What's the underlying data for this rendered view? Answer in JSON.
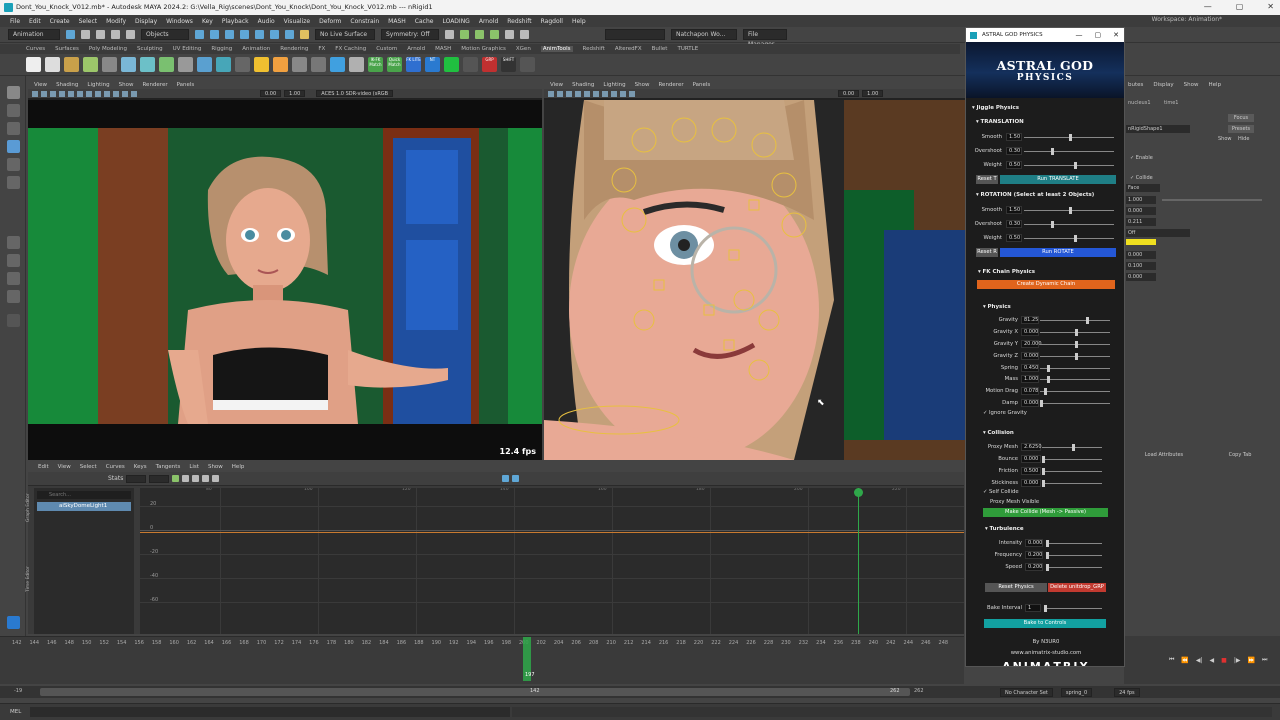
{
  "window": {
    "title": "Dont_You_Knock_V012.mb* - Autodesk MAYA 2024.2: G:\\Vella_Rig\\scenes\\Dont_You_Knock\\Dont_You_Knock_V012.mb  ---  nRigid1",
    "buttons": [
      "—",
      "▢",
      "✕"
    ]
  },
  "menubar": {
    "items": [
      "File",
      "Edit",
      "Create",
      "Select",
      "Modify",
      "Display",
      "Windows",
      "Key",
      "Playback",
      "Audio",
      "Visualize",
      "Deform",
      "Constrain",
      "MASH",
      "Cache",
      "LOADING",
      "Arnold",
      "Redshift",
      "Ragdoll",
      "Help"
    ],
    "workspace_label": "Workspace:",
    "workspace_value": "Animation*"
  },
  "statusline": {
    "mode": "Animation",
    "objects": "Objects",
    "live_surface": "No Live Surface",
    "symmetry": "Symmetry: Off",
    "user": "Natchapon Wo...",
    "file_manager": "File Manager"
  },
  "shelf": {
    "tabs": [
      "Curves",
      "Surfaces",
      "Poly Modeling",
      "Sculpting",
      "UV Editing",
      "Rigging",
      "Animation",
      "Rendering",
      "FX",
      "FX Caching",
      "Custom",
      "Arnold",
      "MASH",
      "Motion Graphics",
      "XGen",
      "AnimTools",
      "Redshift",
      "AlteredFX",
      "Bullet",
      "TURTLE"
    ],
    "active_tab": "AnimTools",
    "icon_labels": [
      "IK-FK Match",
      "Quick Match",
      "FK LITE",
      "NT",
      "GRP",
      "SHIFT"
    ]
  },
  "viewport1": {
    "menu": [
      "View",
      "Shading",
      "Lighting",
      "Show",
      "Renderer",
      "Panels"
    ],
    "near": "0.00",
    "far": "1.00",
    "colorspace": "ACES 1.0 SDR-video (sRGB",
    "fps": "12.4 fps"
  },
  "viewport2": {
    "menu": [
      "View",
      "Shading",
      "Lighting",
      "Show",
      "Renderer",
      "Panels"
    ],
    "near": "0.00",
    "far": "1.00"
  },
  "graph_editor": {
    "menu": [
      "Edit",
      "View",
      "Select",
      "Curves",
      "Keys",
      "Tangents",
      "List",
      "Show",
      "Help"
    ],
    "stats_label": "Stats",
    "search_placeholder": "Search...",
    "outliner_item": "aiSkyDomeLight1",
    "side_labels": [
      "Graph Editor",
      "Time Editor"
    ],
    "y_labels": [
      "20",
      "0",
      "-20",
      "-40",
      "-60"
    ],
    "frame_labels": [
      "80",
      "100",
      "120",
      "140",
      "160",
      "180",
      "200",
      "220"
    ]
  },
  "timeslider": {
    "ticks": [
      "142",
      "144",
      "146",
      "148",
      "150",
      "152",
      "154",
      "156",
      "158",
      "160",
      "162",
      "164",
      "166",
      "168",
      "170",
      "172",
      "174",
      "176",
      "178",
      "180",
      "182",
      "184",
      "186",
      "188",
      "190",
      "192",
      "194",
      "196",
      "198",
      "200",
      "202",
      "204",
      "206",
      "208",
      "210",
      "212",
      "214",
      "216",
      "218",
      "220",
      "222",
      "224",
      "226",
      "228",
      "230",
      "232",
      "234",
      "236",
      "238",
      "240",
      "242",
      "244",
      "246",
      "248"
    ],
    "current_frame": "197",
    "range_start_outer": "-19",
    "range_start": "142",
    "range_end": "262",
    "range_end_outer": "262",
    "character_set": "No Character Set",
    "anim_layer": "spring_0",
    "fps": "24 fps"
  },
  "right_panel": {
    "tabs": [
      "butes",
      "Display",
      "Show",
      "Help"
    ],
    "nodes": [
      "nucleus1",
      "time1"
    ],
    "shape": "nRigidShape1",
    "focus": "Focus",
    "presets": "Presets",
    "show": "Show",
    "hide": "Hide",
    "enable": "Enable",
    "collide": "Collide",
    "face": "Face",
    "off": "Off",
    "values": [
      "1.000",
      "0.000",
      "0.211",
      "0.000",
      "0.100",
      "0.000"
    ],
    "load_attributes": "Load Attributes",
    "copy_tab": "Copy Tab",
    "side_tabs": [
      "Channel Box / Layer Editor",
      "Modeling Toolkit",
      "Attribute Editor",
      "Tool Settings",
      "Outliner"
    ]
  },
  "mel": "MEL",
  "plugin": {
    "title": "ASTRAL GOD PHYSICS",
    "banner_line1": "ASTRAL GOD",
    "banner_line2": "PHYSICS",
    "jiggle_header": "Jiggle Physics",
    "translation_header": "TRANSLATION",
    "translation": [
      {
        "label": "Smooth",
        "value": "1.50",
        "level": 0.5
      },
      {
        "label": "Overshoot",
        "value": "0.30",
        "level": 0.3
      },
      {
        "label": "Weight",
        "value": "0.50",
        "level": 0.55
      }
    ],
    "reset_t": "Reset T",
    "run_translate": "Run TRANSLATE",
    "rotation_header": "ROTATION (Select at least 2 Objects)",
    "rotation": [
      {
        "label": "Smooth",
        "value": "1.50",
        "level": 0.5
      },
      {
        "label": "Overshoot",
        "value": "0.30",
        "level": 0.3
      },
      {
        "label": "Weight",
        "value": "0.50",
        "level": 0.55
      }
    ],
    "reset_r": "Reset R",
    "run_rotate": "Run ROTATE",
    "fk_header": "FK Chain Physics",
    "create_chain": "Create Dynamic Chain",
    "physics_header": "Physics",
    "physics": [
      {
        "label": "Gravity",
        "value": "81.25",
        "level": 0.65
      },
      {
        "label": "Gravity X",
        "value": "0.000",
        "level": 0.5
      },
      {
        "label": "Gravity Y",
        "value": "20.000",
        "level": 0.5
      },
      {
        "label": "Gravity Z",
        "value": "0.000",
        "level": 0.5
      },
      {
        "label": "Spring",
        "value": "0.450",
        "level": 0.1
      },
      {
        "label": "Mass",
        "value": "1.000",
        "level": 0.1
      },
      {
        "label": "Motion Drag",
        "value": "0.078",
        "level": 0.05
      },
      {
        "label": "Damp",
        "value": "0.000",
        "level": 0.0
      }
    ],
    "ignore_gravity": "Ignore Gravity",
    "collision_header": "Collision",
    "collision": [
      {
        "label": "Proxy Mesh",
        "value": "2.6250",
        "level": 0.5
      },
      {
        "label": "Bounce",
        "value": "0.000",
        "level": 0.0
      },
      {
        "label": "Friction",
        "value": "0.500",
        "level": 0.0
      },
      {
        "label": "Stickiness",
        "value": "0.000",
        "level": 0.0
      }
    ],
    "self_collide": "Self Collide",
    "proxy_visible": "Proxy Mesh Visible",
    "make_collide": "Make Collide (Mesh -> Passive)",
    "turbulence_header": "Turbulence",
    "turbulence": [
      {
        "label": "Intensity",
        "value": "0.000",
        "level": 0.0
      },
      {
        "label": "Frequency",
        "value": "0.200",
        "level": 0.0
      },
      {
        "label": "Speed",
        "value": "0.200",
        "level": 0.0
      }
    ],
    "reset_physics": "Reset Physics",
    "delete_grp": "Delete unitdrop_GRP",
    "bake_interval_label": "Bake Interval",
    "bake_interval_value": "1",
    "bake_button": "Bake to Controls",
    "by": "By N3UR0",
    "site": "www.animatrix-studio.com",
    "logo": "ΛNIMΛTRIX"
  }
}
